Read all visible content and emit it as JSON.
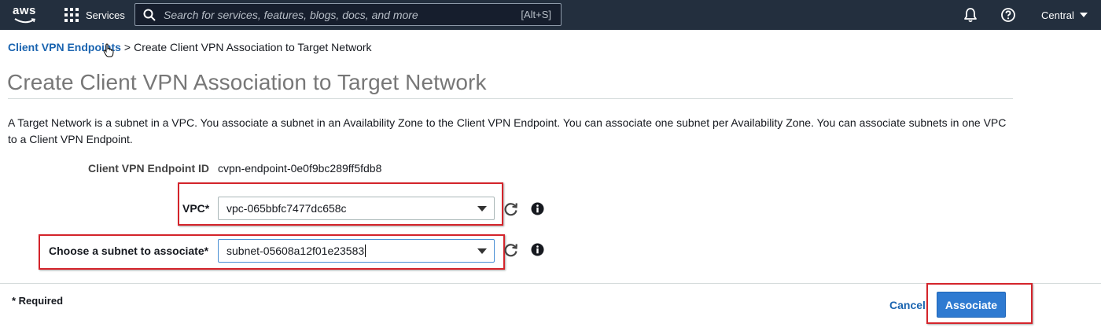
{
  "topnav": {
    "logo_text": "aws",
    "services_label": "Services",
    "search_placeholder": "Search for services, features, blogs, docs, and more",
    "search_shortcut": "[Alt+S]",
    "region_label": "Central",
    "background_color": "#232f3e"
  },
  "breadcrumb": {
    "parent_link": "Client VPN Endpoints",
    "separator": ">",
    "current": "Create Client VPN Association to Target Network"
  },
  "page": {
    "title": "Create Client VPN Association to Target Network",
    "description": "A Target Network is a subnet in a VPC. You associate a subnet in an Availability Zone to the Client VPN Endpoint. You can associate one subnet per Availability Zone. You can associate subnets in one VPC to a Client VPN Endpoint."
  },
  "form": {
    "endpoint_label": "Client VPN Endpoint ID",
    "endpoint_value": "cvpn-endpoint-0e0f9bc289ff5fdb8",
    "vpc_label": "VPC*",
    "vpc_value": "vpc-065bbfc7477dc658c",
    "subnet_label": "Choose a subnet to associate*",
    "subnet_value": "subnet-05608a12f01e23583"
  },
  "footer": {
    "required_note": "* Required",
    "cancel_label": "Cancel",
    "associate_label": "Associate"
  },
  "colors": {
    "link": "#1a64b0",
    "primary_button": "#2e7ad1",
    "highlight_box": "#d4242b"
  },
  "icons": {
    "search": "search-icon",
    "notifications": "bell-icon",
    "help": "help-icon",
    "refresh": "refresh-icon",
    "info": "info-icon",
    "services": "grid-icon",
    "pointer": "hand-cursor-icon"
  }
}
